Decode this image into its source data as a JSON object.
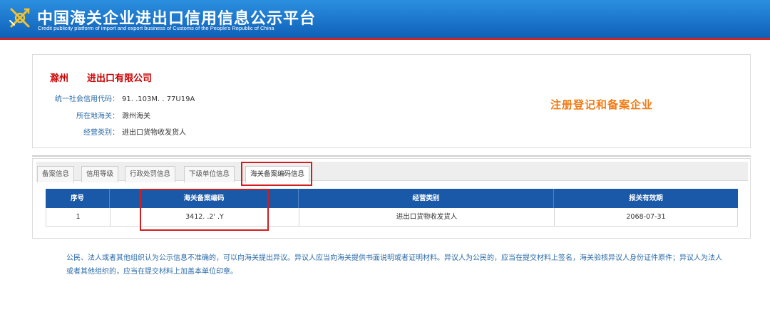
{
  "header": {
    "title": "中国海关企业进出口信用信息公示平台",
    "subtitle": "Credit publicity platform of import and export business of Customs of the People's Republic of China",
    "logo_icon": "customs-emblem-icon",
    "brand_color": "#1467c0",
    "accent_color": "#c8262b"
  },
  "company": {
    "name": "滁州　　进出口有限公司",
    "fields": [
      {
        "label": "统一社会信用代码：",
        "value": "91.  .103M.  .  77U19A"
      },
      {
        "label": "所在地海关：",
        "value": "滁州海关"
      },
      {
        "label": "经营类别：",
        "value": "进出口货物收发货人"
      }
    ],
    "status_badge": "注册登记和备案企业"
  },
  "tabs": [
    {
      "label": "备案信息",
      "active": false
    },
    {
      "label": "信用等级",
      "active": false
    },
    {
      "label": "行政处罚信息",
      "active": false
    },
    {
      "label": "下级单位信息",
      "active": false
    },
    {
      "label": "海关备案编码信息",
      "active": true
    }
  ],
  "table": {
    "columns": [
      "序号",
      "海关备案编码",
      "经营类别",
      "报关有效期"
    ],
    "rows": [
      [
        "1",
        "3412. .2' .Y",
        "进出口货物收发货人",
        "2068-07-31"
      ]
    ]
  },
  "notice": "公民、法人或者其他组织认为公示信息不准确的，可以向海关提出异议。异议人应当向海关提供书面说明或者证明材料。异议人为公民的，应当在提交材料上签名，海关验核异议人身份证件原件；异议人为法人或者其他组织的，应当在提交材料上加盖本单位印章。"
}
